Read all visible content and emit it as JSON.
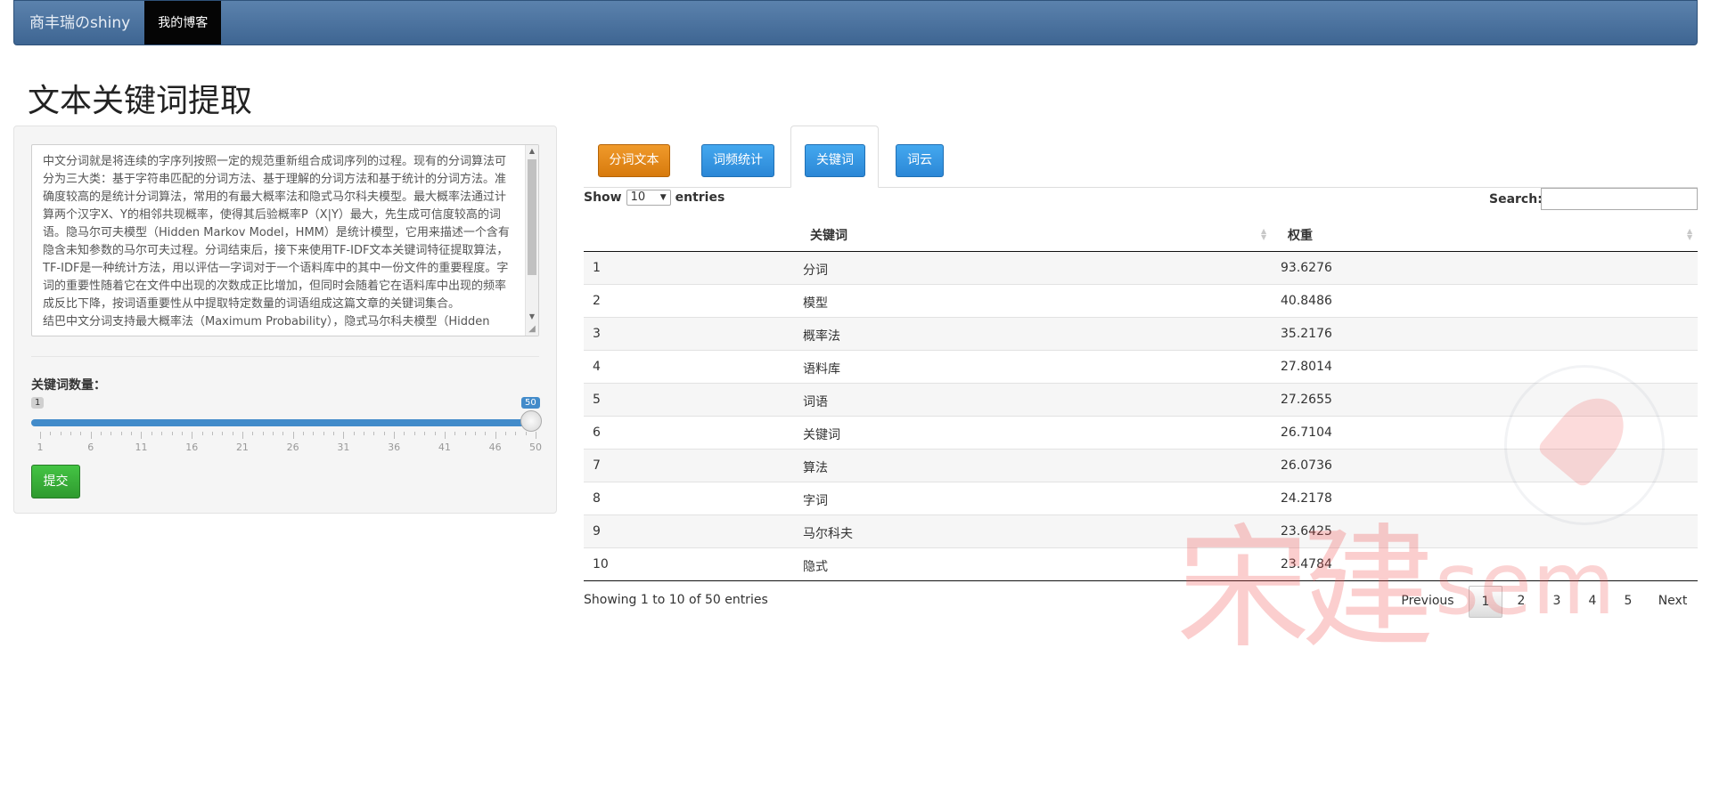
{
  "navbar": {
    "brand": "商丰瑞のshiny",
    "active_item": "我的博客"
  },
  "page": {
    "title": "文本关键词提取"
  },
  "sidebar": {
    "textarea_text": "中文分词就是将连续的字序列按照一定的规范重新组合成词序列的过程。现有的分词算法可分为三大类：基于字符串匹配的分词方法、基于理解的分词方法和基于统计的分词方法。准确度较高的是统计分词算法，常用的有最大概率法和隐式马尔科夫模型。最大概率法通过计算两个汉字X、Y的相邻共现概率，使得其后验概率P（X|Y）最大，先生成可信度较高的词语。隐马尔可夫模型（Hidden Markov Model，HMM）是统计模型，它用来描述一个含有隐含未知参数的马尔可夫过程。分词结束后，接下来使用TF-IDF文本关键词特征提取算法，TF-IDF是一种统计方法，用以评估一字词对于一个语料库中的其中一份文件的重要程度。字词的重要性随着它在文件中出现的次数成正比增加，但同时会随着它在语料库中出现的频率成反比下降，按词语重要性从中提取特定数量的词语组成这篇文章的关键词集合。\n结巴中文分词支持最大概率法（Maximum Probability），隐式马尔科夫模型（Hidden",
    "slider": {
      "label": "关键词数量：",
      "min_badge": "1",
      "max_badge": "50",
      "value": 50,
      "min": 1,
      "max": 50,
      "tick_labels": [
        "1",
        "6",
        "11",
        "16",
        "21",
        "26",
        "31",
        "36",
        "41",
        "46",
        "50"
      ]
    },
    "submit_label": "提交"
  },
  "tabs": [
    {
      "label": "分词文本",
      "color": "#e88a1c",
      "active": false
    },
    {
      "label": "词频统计",
      "color": "#3a9ae6",
      "active": false
    },
    {
      "label": "关键词",
      "color": "#3a9ae6",
      "active": true
    },
    {
      "label": "词云",
      "color": "#3a9ae6",
      "active": false
    }
  ],
  "datatable": {
    "show_label": "Show",
    "length_value": "10",
    "entries_label": "entries",
    "search_label": "Search:",
    "search_value": "",
    "columns": [
      "",
      "关键词",
      "权重"
    ],
    "rows": [
      [
        "1",
        "分词",
        "93.6276"
      ],
      [
        "2",
        "模型",
        "40.8486"
      ],
      [
        "3",
        "概率法",
        "35.2176"
      ],
      [
        "4",
        "语料库",
        "27.8014"
      ],
      [
        "5",
        "词语",
        "27.2655"
      ],
      [
        "6",
        "关键词",
        "26.7104"
      ],
      [
        "7",
        "算法",
        "26.0736"
      ],
      [
        "8",
        "字词",
        "24.2178"
      ],
      [
        "9",
        "马尔科夫",
        "23.6425"
      ],
      [
        "10",
        "隐式",
        "23.4784"
      ]
    ],
    "info": "Showing 1 to 10 of 50 entries",
    "pagination": {
      "previous": "Previous",
      "pages": [
        "1",
        "2",
        "3",
        "4",
        "5"
      ],
      "current": "1",
      "next": "Next"
    }
  },
  "watermark": {
    "text": "宋建",
    "sub": "sem"
  },
  "colors": {
    "navbar": "#4a72a0",
    "accent_blue": "#428bca",
    "submit_green": "#3cb53c",
    "tab_orange": "#e88a1c",
    "tab_blue": "#3a9ae6"
  }
}
